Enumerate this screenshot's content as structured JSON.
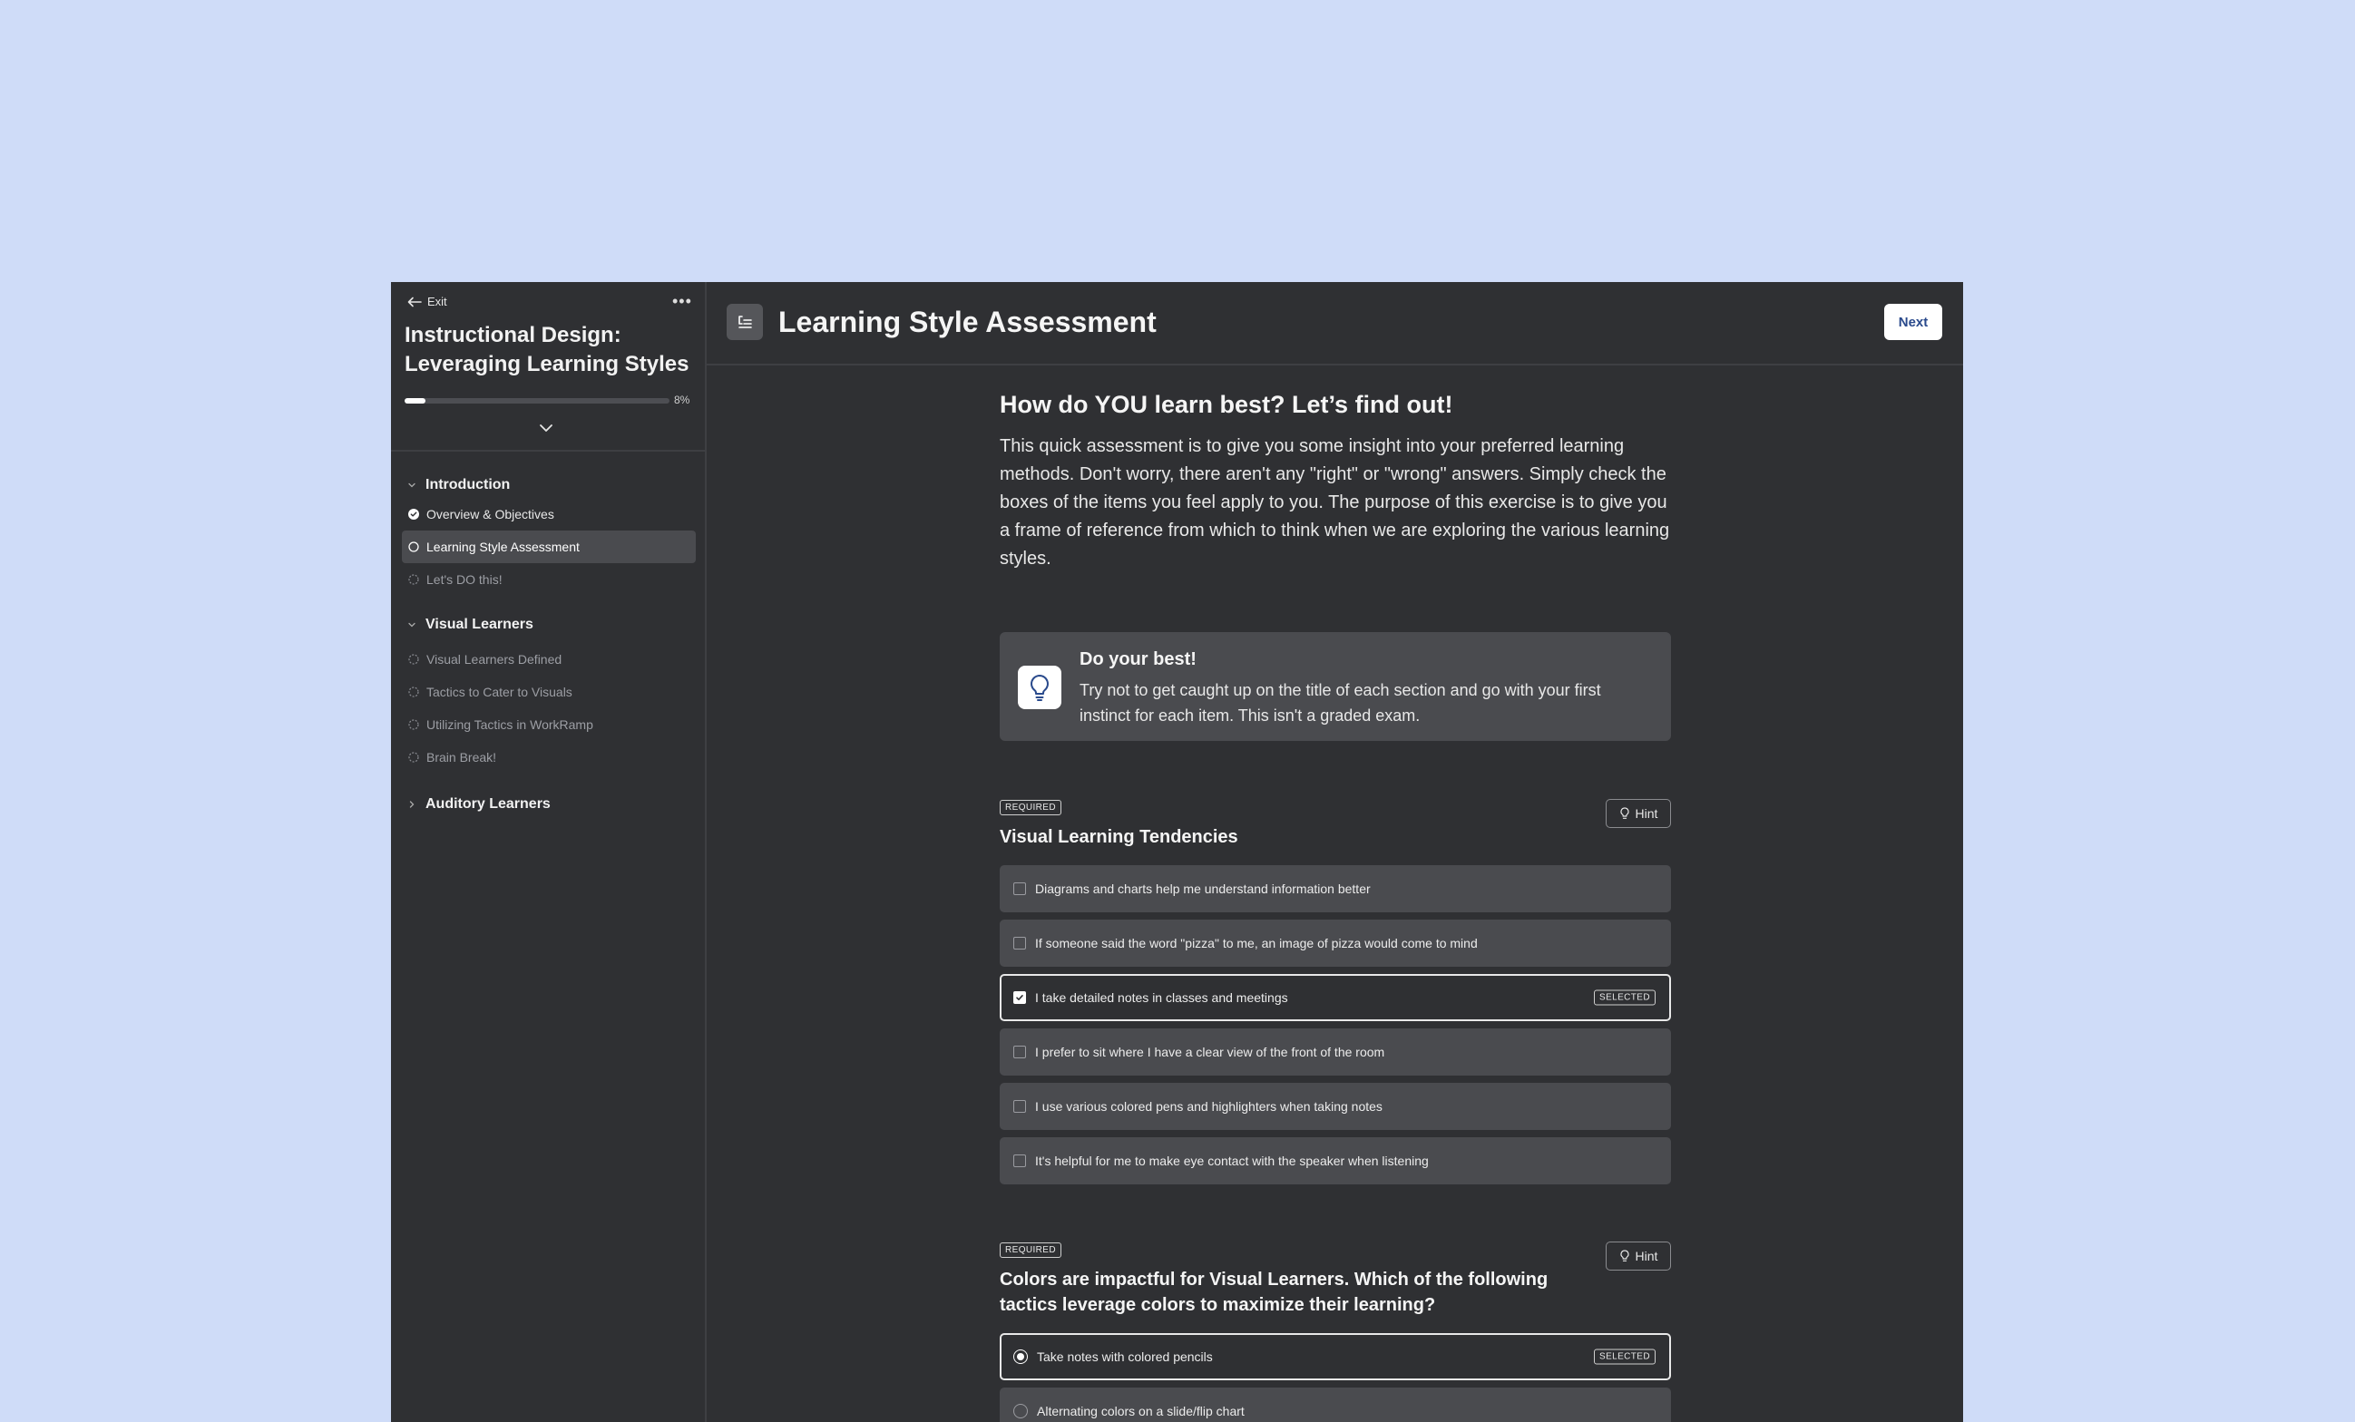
{
  "sidebar": {
    "exit_label": "Exit",
    "more_label": "•••",
    "course_title": "Instructional Design: Leveraging Learning Styles",
    "progress_percent": 8,
    "progress_label": "8%",
    "sections": [
      {
        "title": "Introduction",
        "expanded": true,
        "lessons": [
          {
            "label": "Overview & Objectives",
            "status": "complete"
          },
          {
            "label": "Learning Style Assessment",
            "status": "current"
          },
          {
            "label": "Let's DO this!",
            "status": "not-started"
          }
        ]
      },
      {
        "title": "Visual Learners",
        "expanded": true,
        "lessons": [
          {
            "label": "Visual Learners Defined",
            "status": "not-started"
          },
          {
            "label": "Tactics to Cater to Visuals",
            "status": "not-started"
          },
          {
            "label": "Utilizing Tactics in WorkRamp",
            "status": "not-started"
          },
          {
            "label": "Brain Break!",
            "status": "not-started"
          }
        ]
      },
      {
        "title": "Auditory Learners",
        "expanded": false,
        "lessons": []
      }
    ]
  },
  "header": {
    "title": "Learning Style Assessment",
    "next_label": "Next"
  },
  "main": {
    "intro_heading": "How do YOU learn best? Let’s find out!",
    "intro_text": "This quick assessment is to give you some insight into your preferred learning methods.  Don't worry, there aren't any \"right\" or \"wrong\" answers.  Simply check the boxes of the items you feel apply to you.  The purpose of this exercise is to give you a frame of reference from which to think when we are exploring the various learning styles.",
    "callout": {
      "title": "Do your best!",
      "text": "Try not to get caught up on the title of each section and go with your first instinct for each item.  This isn't a graded exam."
    },
    "questions": [
      {
        "badge": "REQUIRED",
        "hint_label": "Hint",
        "title": "Visual Learning Tendencies",
        "type": "checkbox",
        "options": [
          {
            "label": "Diagrams and charts help me understand information better",
            "selected": false
          },
          {
            "label": "If someone said the word \"pizza\" to me, an image of pizza would come to mind",
            "selected": false
          },
          {
            "label": "I take detailed notes in classes and meetings",
            "selected": true
          },
          {
            "label": "I prefer to sit where I have a clear view of the front of the room",
            "selected": false
          },
          {
            "label": "I use various colored pens and highlighters when taking notes",
            "selected": false
          },
          {
            "label": "It's helpful for me to make eye contact with the speaker when listening",
            "selected": false
          }
        ]
      },
      {
        "badge": "REQUIRED",
        "hint_label": "Hint",
        "title": "Colors are impactful for Visual Learners. Which of the following tactics leverage colors to maximize their learning?",
        "type": "radio",
        "options": [
          {
            "label": "Take notes with colored pencils",
            "selected": true
          },
          {
            "label": "Alternating colors on a slide/flip chart",
            "selected": false
          }
        ]
      }
    ],
    "selected_badge": "SELECTED"
  }
}
